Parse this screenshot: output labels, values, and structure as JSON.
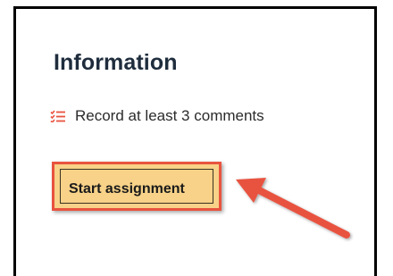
{
  "panel": {
    "title": "Information",
    "requirement": {
      "icon": "checklist-icon",
      "text": "Record at least 3 comments"
    },
    "start_button_label": "Start assignment"
  },
  "annotation": {
    "arrow": "callout-arrow-icon",
    "color": "#e8533f"
  },
  "colors": {
    "button_fill": "#f7d288",
    "highlight_border": "#e8533f",
    "title_text": "#1f2d3d"
  }
}
